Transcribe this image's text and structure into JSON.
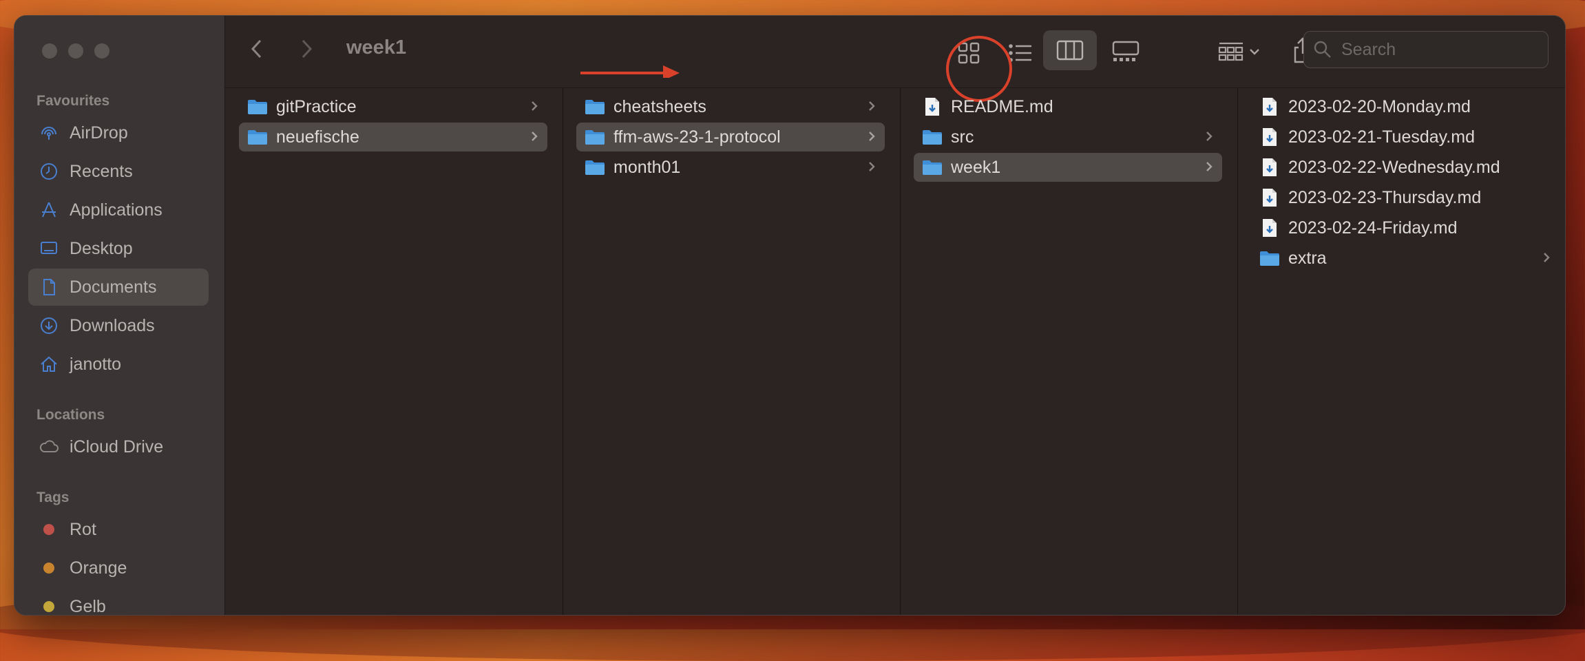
{
  "window": {
    "title": "week1"
  },
  "toolbar": {
    "back_label": "back",
    "forward_label": "forward",
    "search_placeholder": "Search"
  },
  "sidebar": {
    "favourites_heading": "Favourites",
    "favourites": [
      {
        "label": "AirDrop",
        "icon": "airdrop-icon"
      },
      {
        "label": "Recents",
        "icon": "clock-icon"
      },
      {
        "label": "Applications",
        "icon": "applications-icon"
      },
      {
        "label": "Desktop",
        "icon": "desktop-icon"
      },
      {
        "label": "Documents",
        "icon": "document-icon",
        "active": true
      },
      {
        "label": "Downloads",
        "icon": "download-icon"
      },
      {
        "label": "janotto",
        "icon": "home-icon"
      }
    ],
    "locations_heading": "Locations",
    "locations": [
      {
        "label": "iCloud Drive",
        "icon": "cloud-icon"
      }
    ],
    "tags_heading": "Tags",
    "tags": [
      {
        "label": "Rot",
        "color": "#c0504a"
      },
      {
        "label": "Orange",
        "color": "#c7832e"
      },
      {
        "label": "Gelb",
        "color": "#c4a73a"
      }
    ]
  },
  "columns": [
    [
      {
        "name": "gitPractice",
        "type": "folder"
      },
      {
        "name": "neuefische",
        "type": "folder",
        "selected": true
      }
    ],
    [
      {
        "name": "cheatsheets",
        "type": "folder"
      },
      {
        "name": "ffm-aws-23-1-protocol",
        "type": "folder",
        "selected": true
      },
      {
        "name": "month01",
        "type": "folder"
      }
    ],
    [
      {
        "name": "README.md",
        "type": "file"
      },
      {
        "name": "src",
        "type": "folder"
      },
      {
        "name": "week1",
        "type": "folder",
        "selected": true
      }
    ],
    [
      {
        "name": "2023-02-20-Monday.md",
        "type": "file"
      },
      {
        "name": "2023-02-21-Tuesday.md",
        "type": "file"
      },
      {
        "name": "2023-02-22-Wednesday.md",
        "type": "file"
      },
      {
        "name": "2023-02-23-Thursday.md",
        "type": "file"
      },
      {
        "name": "2023-02-24-Friday.md",
        "type": "file"
      },
      {
        "name": "extra",
        "type": "folder"
      }
    ]
  ],
  "colors": {
    "accent_annotation": "#d9412b",
    "folder": "#5aa9e6"
  }
}
